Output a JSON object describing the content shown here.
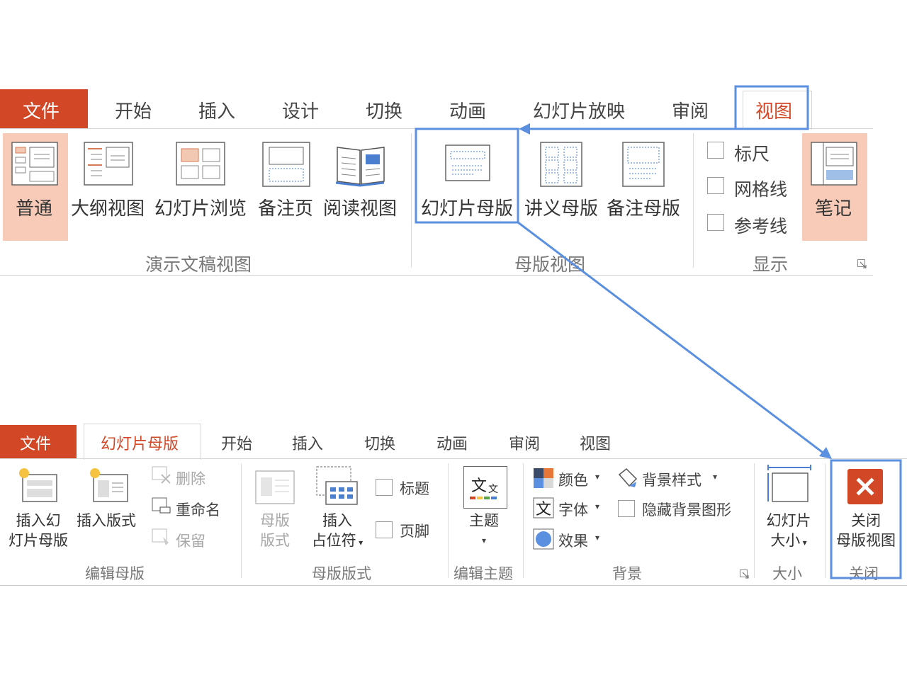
{
  "top_ribbon": {
    "tabs": {
      "file": "文件",
      "home": "开始",
      "insert": "插入",
      "design": "设计",
      "transitions": "切换",
      "animations": "动画",
      "slideshow": "幻灯片放映",
      "review": "审阅",
      "view": "视图"
    },
    "presentation_views": {
      "normal": "普通",
      "outline": "大纲视图",
      "sorter": "幻灯片浏览",
      "notes_page": "备注页",
      "reading": "阅读视图",
      "group_label": "演示文稿视图"
    },
    "master_views": {
      "slide_master": "幻灯片母版",
      "handout_master": "讲义母版",
      "notes_master": "备注母版",
      "group_label": "母版视图"
    },
    "show": {
      "ruler": "标尺",
      "gridlines": "网格线",
      "guides": "参考线",
      "group_label": "显示"
    },
    "notes_button": "笔记"
  },
  "bottom_ribbon": {
    "tabs": {
      "file": "文件",
      "slide_master": "幻灯片母版",
      "home": "开始",
      "insert": "插入",
      "transitions": "切换",
      "animations": "动画",
      "review": "审阅",
      "view": "视图"
    },
    "edit_master": {
      "insert_slide_master_line1": "插入幻",
      "insert_slide_master_line2": "灯片母版",
      "insert_layout": "插入版式",
      "delete": "删除",
      "rename": "重命名",
      "preserve": "保留",
      "group_label": "编辑母版"
    },
    "master_layout": {
      "master_layout_line1": "母版",
      "master_layout_line2": "版式",
      "insert_placeholder_line1": "插入",
      "insert_placeholder_line2": "占位符",
      "title": "标题",
      "footers": "页脚",
      "group_label": "母版版式"
    },
    "edit_theme": {
      "themes": "主题",
      "group_label": "编辑主题"
    },
    "background": {
      "colors": "颜色",
      "fonts": "字体",
      "effects": "效果",
      "background_styles": "背景样式",
      "hide_background_graphics": "隐藏背景图形",
      "group_label": "背景"
    },
    "size": {
      "slide_size_line1": "幻灯片",
      "slide_size_line2": "大小",
      "group_label": "大小"
    },
    "close": {
      "close_line1": "关闭",
      "close_line2": "母版视图",
      "group_label": "关闭"
    }
  },
  "colors": {
    "file_tab": "#d24726",
    "active_tab_text": "#d24726",
    "highlight_box": "#5b8fe0",
    "selected_button": "#f8cbb9",
    "close_icon": "#d24726"
  },
  "icons": [
    "slide-master-icon",
    "handout-master-icon",
    "notes-master-icon",
    "close-master-icon",
    "themes-icon",
    "colors-icon",
    "fonts-icon",
    "effects-icon",
    "background-styles-icon",
    "slide-size-icon"
  ]
}
